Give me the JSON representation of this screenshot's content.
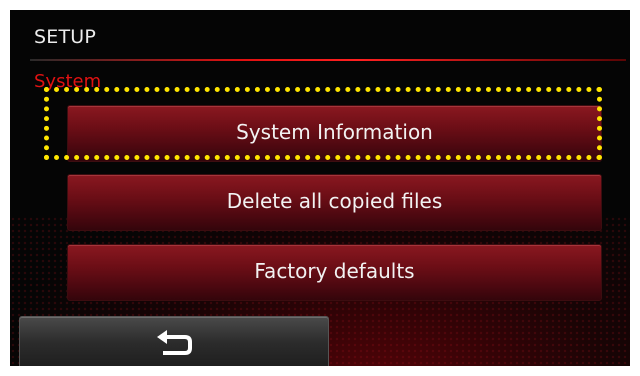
{
  "header": {
    "title": "SETUP"
  },
  "section": {
    "label": "System"
  },
  "menu": {
    "items": [
      {
        "label": "System Information",
        "highlighted": true
      },
      {
        "label": "Delete all copied files",
        "highlighted": false
      },
      {
        "label": "Factory defaults",
        "highlighted": false
      }
    ]
  },
  "footer": {
    "back_icon": "back-return-arrow-icon"
  },
  "colors": {
    "accent": "#e01212",
    "highlight_outline": "#ffe600",
    "button_red": "#6c0e16",
    "background": "#050505"
  }
}
